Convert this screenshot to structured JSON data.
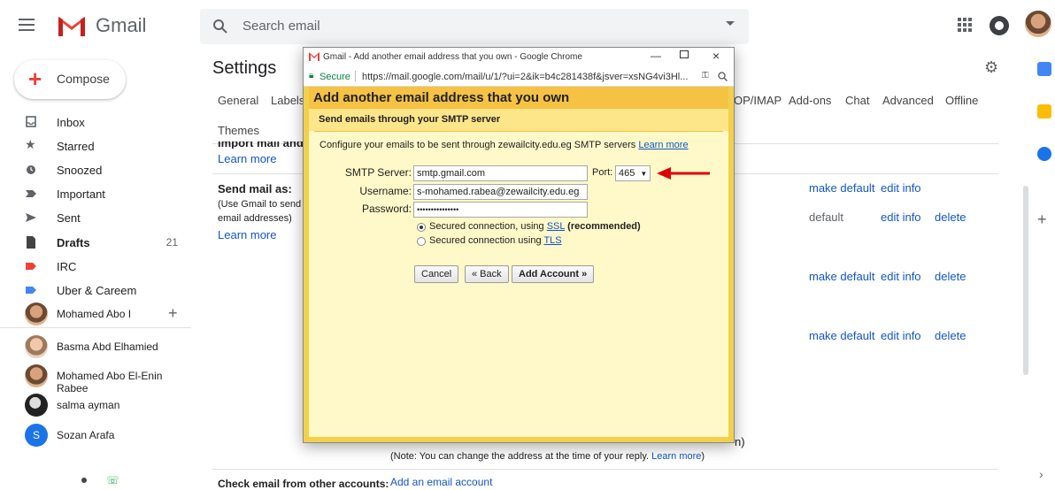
{
  "topbar": {
    "app_name": "Gmail",
    "search_placeholder": "Search email"
  },
  "sidebar": {
    "compose_label": "Compose",
    "items": [
      {
        "label": "Inbox",
        "count": ""
      },
      {
        "label": "Starred",
        "count": ""
      },
      {
        "label": "Snoozed",
        "count": ""
      },
      {
        "label": "Important",
        "count": ""
      },
      {
        "label": "Sent",
        "count": ""
      },
      {
        "label": "Drafts",
        "count": "21"
      },
      {
        "label": "IRC",
        "count": ""
      },
      {
        "label": "Uber & Careem",
        "count": ""
      }
    ],
    "hangouts_user": "Mohamed Abo I",
    "contacts": [
      "Basma Abd Elhamied",
      "Mohamed Abo El-Enin Rabee",
      "salma ayman",
      "Sozan Arafa"
    ],
    "contact_initial": "S"
  },
  "settings": {
    "title": "Settings",
    "tabs": [
      "General",
      "Labels",
      "OP/IMAP",
      "Add-ons",
      "Chat",
      "Advanced",
      "Offline"
    ],
    "tab_themes": "Themes",
    "import_partial": "Import mail and c",
    "learn_more": "Learn more",
    "send_mail_as": "Send mail as:",
    "send_mail_help_1": "(Use Gmail to send f",
    "send_mail_help_2": "email addresses)",
    "learn_more_2": "Learn more",
    "row_actions": [
      {
        "a": "make default",
        "b": "edit info",
        "c": ""
      },
      {
        "a": "default",
        "b": "edit info",
        "c": "delete"
      },
      {
        "a": "make default",
        "b": "edit info",
        "c": "delete"
      },
      {
        "a": "make default",
        "b": "edit info",
        "c": "delete"
      }
    ],
    "reply_partial": "n)",
    "note": "(Note: You can change the address at the time of your reply.",
    "note_link": "Learn more",
    "note_end": ")",
    "check_email": "Check email from other accounts:",
    "add_account_link": "Add an email account"
  },
  "popup": {
    "window_title": "Gmail - Add another email address that you own - Google Chrome",
    "secure_label": "Secure",
    "url": "https://mail.google.com/mail/u/1/?ui=2&ik=b4c281438f&jsver=xsNG4vi3Hl...",
    "header": "Add another email address that you own",
    "subheader": "Send emails through your SMTP server",
    "intro": "Configure your emails to be sent through zewailcity.edu.eg SMTP servers",
    "intro_link": "Learn more",
    "smtp_label": "SMTP Server:",
    "smtp_value": "smtp.gmail.com",
    "port_label": "Port:",
    "port_value": "465",
    "username_label": "Username:",
    "username_value": "s-mohamed.rabea@zewailcity.edu.eg",
    "password_label": "Password:",
    "password_value": "•••••••••••••••",
    "ssl_text": "Secured connection, using",
    "ssl_link": "SSL",
    "ssl_rec": "(recommended)",
    "tls_text": "Secured connection using",
    "tls_link": "TLS",
    "cancel": "Cancel",
    "back": "« Back",
    "add_account": "Add Account »"
  },
  "colors": {
    "accent_red": "#ea4335",
    "link": "#1155cc",
    "popup_header": "#f6c243",
    "popup_body": "#fff8c8",
    "annotation_arrow": "#e0000a"
  }
}
